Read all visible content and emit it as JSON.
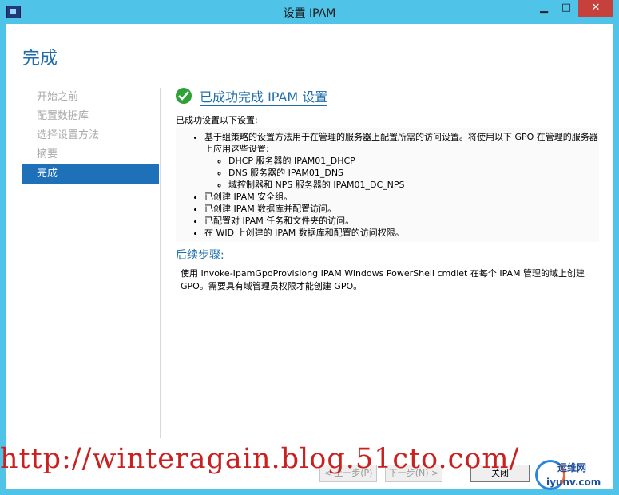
{
  "window": {
    "title": "设置 IPAM",
    "min": "▁",
    "max": "□",
    "close": "✕"
  },
  "page_title": "完成",
  "nav": {
    "items": [
      {
        "label": "开始之前"
      },
      {
        "label": "配置数据库"
      },
      {
        "label": "选择设置方法"
      },
      {
        "label": "摘要"
      },
      {
        "label": "完成"
      }
    ]
  },
  "main": {
    "success": "已成功完成 IPAM 设置",
    "intro": "已成功设置以下设置:",
    "bullet1": "基于组策略的设置方法用于在管理的服务器上配置所需的访问设置。将使用以下 GPO 在管理的服务器上应用这些设置:",
    "sub1": "DHCP 服务器的 IPAM01_DHCP",
    "sub2": "DNS 服务器的 IPAM01_DNS",
    "sub3": "域控制器和 NPS 服务器的 IPAM01_DC_NPS",
    "bullet2": "已创建 IPAM 安全组。",
    "bullet3": "已创建 IPAM 数据库并配置访问。",
    "bullet4": "已配置对 IPAM 任务和文件夹的访问。",
    "bullet5": "在 WID 上创建的 IPAM 数据库和配置的访问权限。",
    "next_title": "后续步骤:",
    "next_text": "使用 Invoke-IpamGpoProvisiong IPAM Windows PowerShell cmdlet 在每个 IPAM 管理的域上创建 GPO。需要具有域管理员权限才能创建 GPO。"
  },
  "footer": {
    "prev": "< 上一步(P)",
    "next": "下一步(N) >",
    "close": "关闭"
  },
  "watermark": "http://winteragain.blog.51cto.com/",
  "logo": {
    "line1": "运维网",
    "line2": "iyunv.com"
  },
  "colors": {
    "title_bar": "#4fc3e8",
    "accent": "#1f6eaa",
    "selected_nav": "#1e70b8",
    "success": "#2ea236"
  }
}
